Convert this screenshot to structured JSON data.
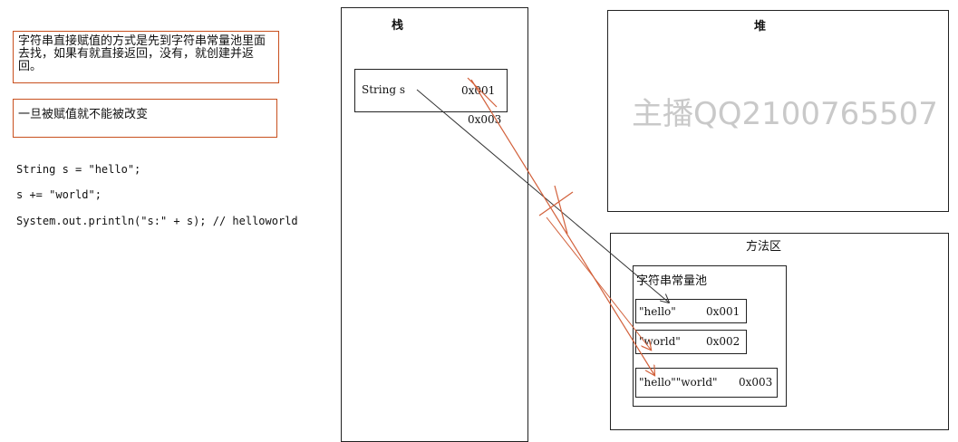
{
  "notes": {
    "pool_lookup": "字符串直接赋值的方式是先到字符串常量池里面去找，如果有就直接返回，没有，就创建并返回。",
    "immutable": "一旦被赋值就不能被改变"
  },
  "code_lines": [
    "String s = \"hello\";",
    "s += \"world\";",
    "System.out.println(\"s:\" + s); // helloworld"
  ],
  "stack": {
    "title": "栈",
    "var_label": "String s",
    "addr_old": "0x001",
    "addr_new": "0x003"
  },
  "heap": {
    "title": "堆",
    "watermark": "主播QQ2100765507"
  },
  "method_area": {
    "title": "方法区",
    "pool_title": "字符串常量池",
    "entries": [
      {
        "value": "\"hello\"",
        "addr": "0x001"
      },
      {
        "value": "\"world\"",
        "addr": "0x002"
      },
      {
        "value": "\"hello\"\"world\"",
        "addr": "0x003"
      }
    ]
  },
  "colors": {
    "note_border": "#c8501e",
    "red_arrow": "#d2603a",
    "black_arrow": "#333333",
    "watermark": "#c9c9c9"
  }
}
